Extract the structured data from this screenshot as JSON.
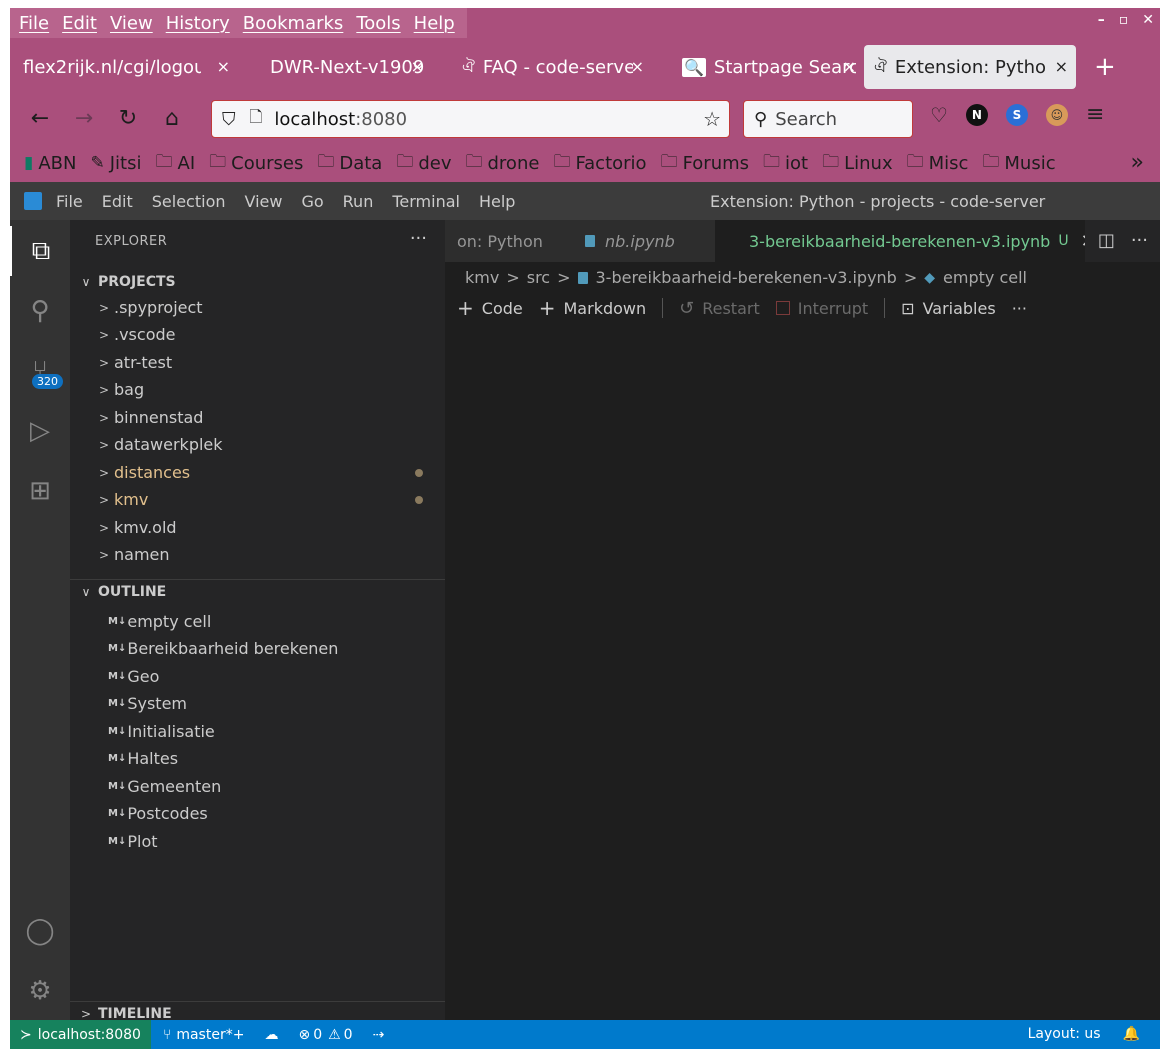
{
  "browser": {
    "menu": [
      "File",
      "Edit",
      "View",
      "History",
      "Bookmarks",
      "Tools",
      "Help"
    ],
    "window_controls": [
      "–",
      "▫",
      "✕"
    ],
    "tabs": [
      {
        "title": "flex2rijk.nl/cgi/logou",
        "close": "×"
      },
      {
        "title": "DWR-Next-v1909",
        "close": "×"
      },
      {
        "title": "FAQ - code-server",
        "close": "×"
      },
      {
        "title": "Startpage Search",
        "close": "×"
      },
      {
        "title": "Extension: Python",
        "close": "×"
      }
    ],
    "new_tab": "+",
    "url_host": "localhost",
    "url_port": ":8080",
    "search_placeholder": "Search",
    "ext_icons": {
      "n": "N",
      "s": "S"
    },
    "bookmarks": [
      "ABN",
      "Jitsi",
      "AI",
      "Courses",
      "Data",
      "dev",
      "drone",
      "Factorio",
      "Forums",
      "iot",
      "Linux",
      "Misc",
      "Music"
    ],
    "bookmarks_more": "»"
  },
  "vscode": {
    "menu": [
      "File",
      "Edit",
      "Selection",
      "View",
      "Go",
      "Run",
      "Terminal",
      "Help"
    ],
    "window_title": "Extension: Python - projects - code-server",
    "scm_badge": "320",
    "explorer_title": "EXPLORER",
    "projects_label": "PROJECTS",
    "folders": [
      {
        "name": ".spyproject"
      },
      {
        "name": ".vscode"
      },
      {
        "name": "atr-test"
      },
      {
        "name": "bag"
      },
      {
        "name": "binnenstad"
      },
      {
        "name": "datawerkplek"
      },
      {
        "name": "distances"
      },
      {
        "name": "kmv"
      },
      {
        "name": "kmv.old"
      },
      {
        "name": "namen"
      }
    ],
    "outline_label": "OUTLINE",
    "outline": [
      "empty cell",
      "Bereikbaarheid berekenen",
      "Geo",
      "System",
      "Initialisatie",
      "Haltes",
      "Gemeenten",
      "Postcodes",
      "Plot"
    ],
    "md_glyph": "M↓",
    "timeline_label": "TIMELINE",
    "editor_tabs": [
      {
        "title": "on: Python"
      },
      {
        "title": "nb.ipynb"
      },
      {
        "title": "3-bereikbaarheid-berekenen-v3.ipynb",
        "status": "U"
      }
    ],
    "breadcrumbs": [
      "kmv",
      "src",
      "3-bereikbaarheid-berekenen-v3.ipynb",
      "empty cell"
    ],
    "toolbar": {
      "code": "Code",
      "markdown": "Markdown",
      "restart": "Restart",
      "interrupt": "Interrupt",
      "variables": "Variables"
    },
    "status": {
      "remote": "localhost:8080",
      "branch": "master*+",
      "errors": "0",
      "warnings": "0",
      "layout": "Layout: us"
    }
  }
}
